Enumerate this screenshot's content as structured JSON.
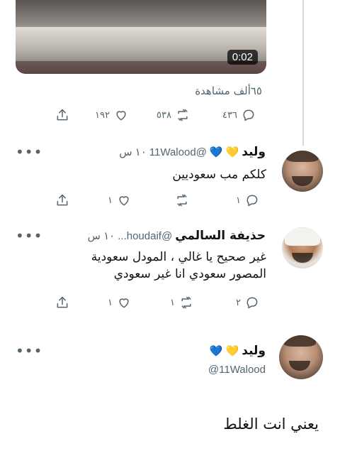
{
  "video": {
    "duration": "0:02"
  },
  "main_tweet": {
    "views": "٦٥ألف مشاهدة",
    "actions": {
      "replies": "٤٣٦",
      "retweets": "٥٣٨",
      "likes": "١٩٢"
    }
  },
  "tweets": [
    {
      "name": "وليد",
      "hearts": [
        "💛",
        "💙"
      ],
      "handle": "@11Walood",
      "time": "١٠ س",
      "text": "كلكم مب سعوديين",
      "actions": {
        "replies": "١",
        "retweets": "",
        "likes": "١"
      }
    },
    {
      "name": "حذيفة السالمي",
      "handle": "@houdaif...",
      "time": "١٠ س",
      "text_line1": "غير صحيح يا غالي ، المودل سعودية",
      "text_line2": "المصور سعودي انا غير سعودي",
      "actions": {
        "replies": "٢",
        "retweets": "١",
        "likes": "١"
      }
    }
  ],
  "composer": {
    "name": "وليد",
    "hearts": [
      "💛",
      "💙"
    ],
    "handle": "@11Walood",
    "reply_text": "يعني انت الغلط"
  },
  "colors": {
    "text": "#0f1419",
    "muted": "#536471",
    "line": "#cfd9de"
  }
}
